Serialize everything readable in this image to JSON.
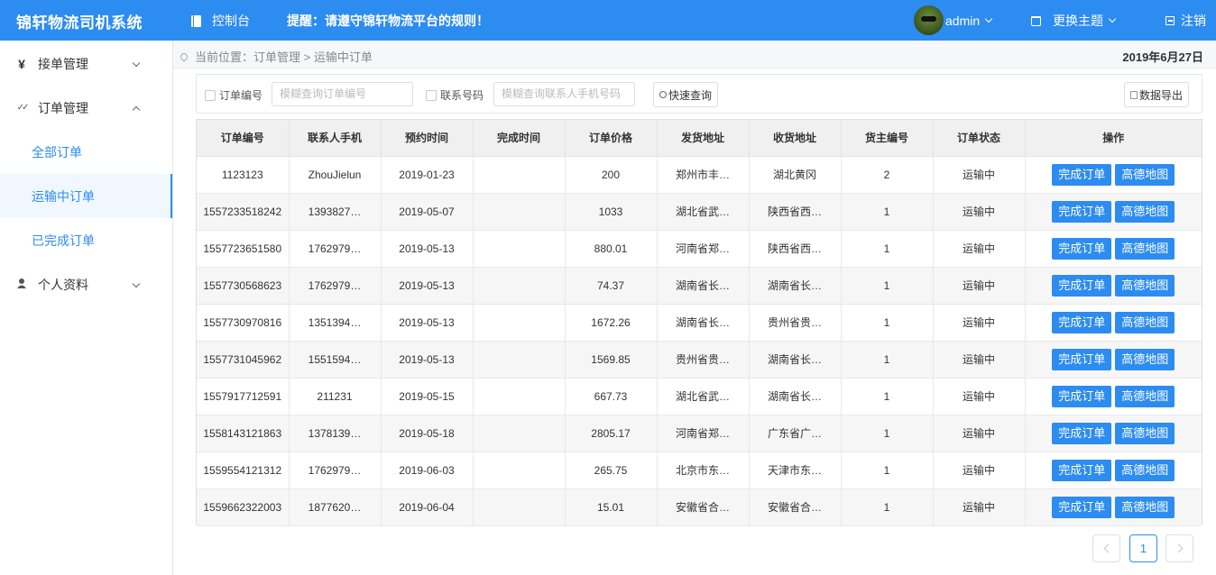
{
  "header": {
    "brand": "锦轩物流司机系统",
    "console": "控制台",
    "notice": "提醒：请遵守锦轩物流平台的规则！",
    "username": "admin",
    "theme": "更换主题",
    "logout": "注销",
    "colors": {
      "primary": "#2d8cf0"
    }
  },
  "sidebar": {
    "menu1": {
      "icon": "¥",
      "label": "接单管理"
    },
    "menu2": {
      "icon": "✓✓",
      "label": "订单管理"
    },
    "sub": [
      "全部订单",
      "运输中订单",
      "已完成订单"
    ],
    "menu3": {
      "icon": "person-icon",
      "label": "个人资料"
    }
  },
  "breadcrumb": {
    "text": "当前位置：订单管理 > 运输中订单",
    "date": "2019年6月27日"
  },
  "filter": {
    "order_label": "订单编号",
    "order_placeholder": "模糊查询订单编号",
    "phone_label": "联系号码",
    "phone_placeholder": "模糊查询联系人手机号码",
    "query_btn": "快速查询",
    "export_btn": "数据导出"
  },
  "table": {
    "headers": [
      "订单编号",
      "联系人手机",
      "预约时间",
      "完成时间",
      "订单价格",
      "发货地址",
      "收货地址",
      "货主编号",
      "订单状态",
      "操作"
    ],
    "complete_btn": "完成订单",
    "map_btn": "高德地图",
    "rows": [
      [
        "1123123",
        "ZhouJielun",
        "2019-01-23",
        "",
        "200",
        "郑州市丰…",
        "湖北黄冈",
        "2",
        "运输中"
      ],
      [
        "1557233518242",
        "1393827…",
        "2019-05-07",
        "",
        "1033",
        "湖北省武…",
        "陕西省西…",
        "1",
        "运输中"
      ],
      [
        "1557723651580",
        "1762979…",
        "2019-05-13",
        "",
        "880.01",
        "河南省郑…",
        "陕西省西…",
        "1",
        "运输中"
      ],
      [
        "1557730568623",
        "1762979…",
        "2019-05-13",
        "",
        "74.37",
        "湖南省长…",
        "湖南省长…",
        "1",
        "运输中"
      ],
      [
        "1557730970816",
        "1351394…",
        "2019-05-13",
        "",
        "1672.26",
        "湖南省长…",
        "贵州省贵…",
        "1",
        "运输中"
      ],
      [
        "1557731045962",
        "1551594…",
        "2019-05-13",
        "",
        "1569.85",
        "贵州省贵…",
        "湖南省长…",
        "1",
        "运输中"
      ],
      [
        "1557917712591",
        "211231",
        "2019-05-15",
        "",
        "667.73",
        "湖北省武…",
        "湖南省长…",
        "1",
        "运输中"
      ],
      [
        "1558143121863",
        "1378139…",
        "2019-05-18",
        "",
        "2805.17",
        "河南省郑…",
        "广东省广…",
        "1",
        "运输中"
      ],
      [
        "1559554121312",
        "1762979…",
        "2019-06-03",
        "",
        "265.75",
        "北京市东…",
        "天津市东…",
        "1",
        "运输中"
      ],
      [
        "1559662322003",
        "1877620…",
        "2019-06-04",
        "",
        "15.01",
        "安徽省合…",
        "安徽省合…",
        "1",
        "运输中"
      ]
    ]
  },
  "pagination": {
    "current": "1"
  }
}
